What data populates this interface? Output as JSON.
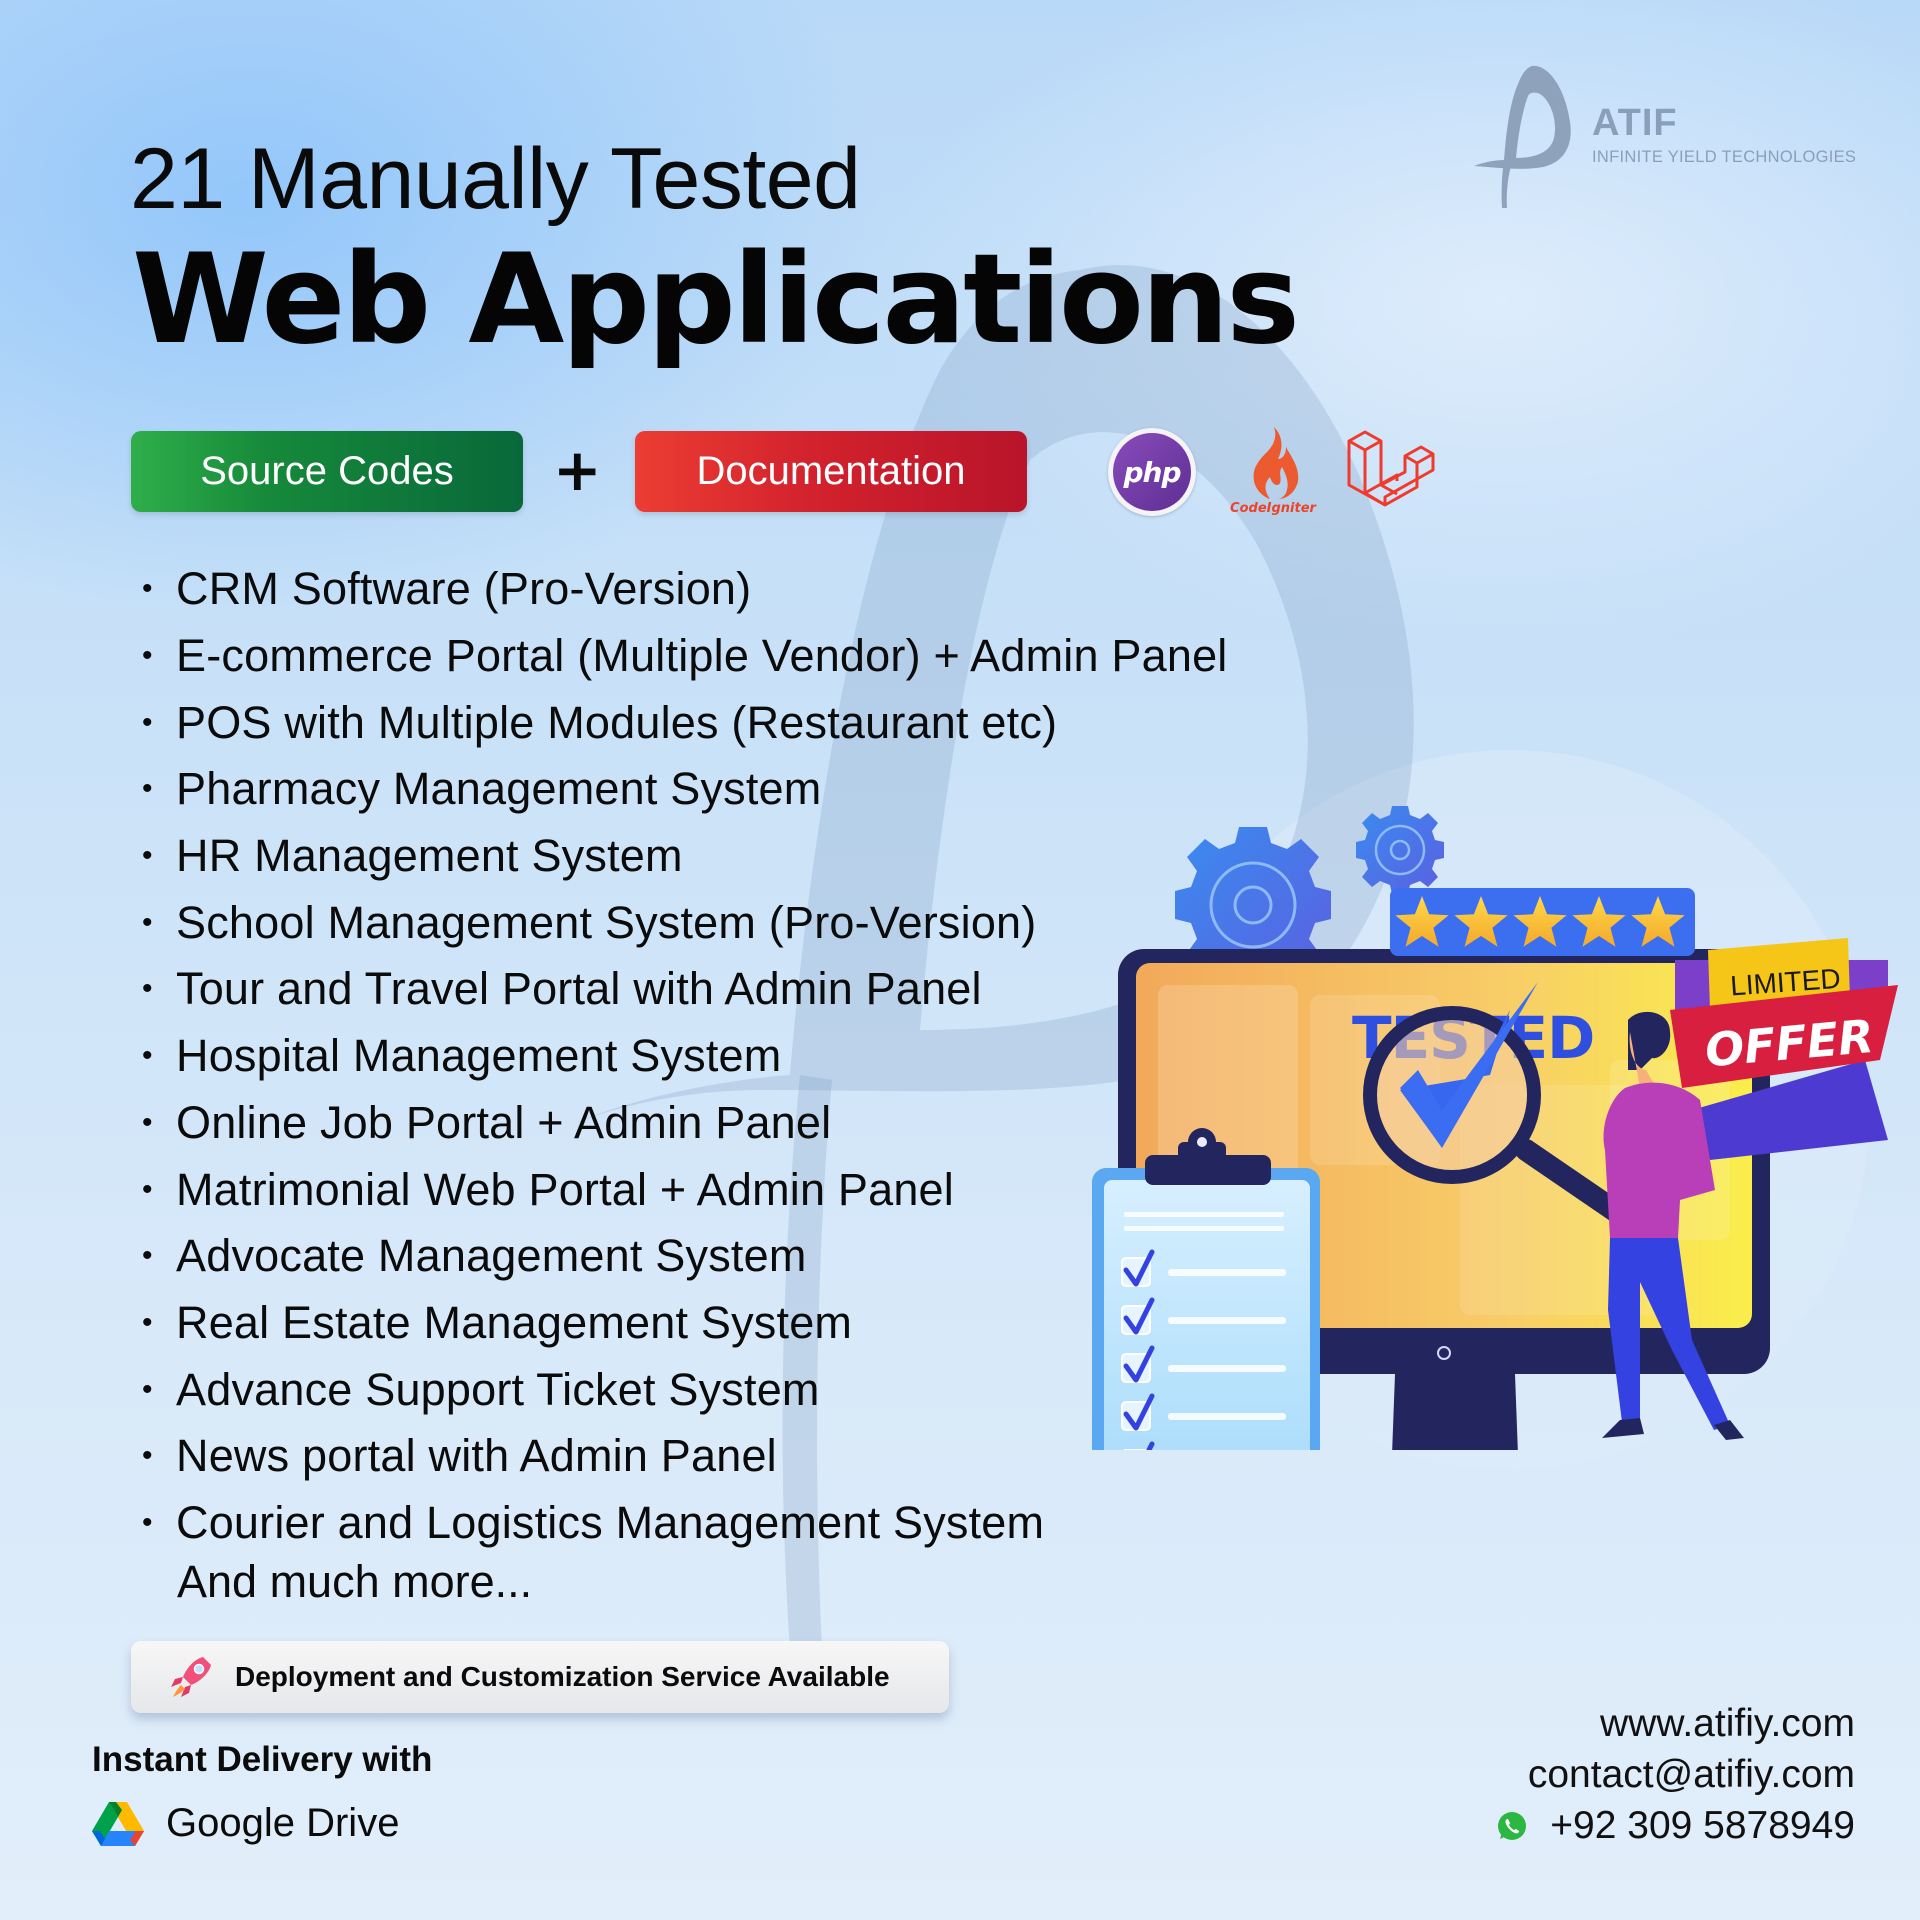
{
  "brand": {
    "name": "ATIF",
    "tagline": "INFINITE YIELD TECHNOLOGIES",
    "logo_icon": "atif-p-logo-icon"
  },
  "header": {
    "subtitle": "21 Manually Tested",
    "title": "Web Applications"
  },
  "badges": {
    "source_codes": "Source Codes",
    "plus": "+",
    "documentation": "Documentation",
    "colors": {
      "source_codes": "#16893a",
      "documentation": "#d2222d"
    }
  },
  "tech_stack": [
    {
      "name": "php",
      "label": "php",
      "icon": "php-logo-icon"
    },
    {
      "name": "codeigniter",
      "label": "CodeIgniter",
      "icon": "codeigniter-flame-icon"
    },
    {
      "name": "laravel",
      "label": "",
      "icon": "laravel-logo-icon"
    }
  ],
  "applications": [
    "CRM Software (Pro-Version)",
    "E-commerce Portal (Multiple Vendor) + Admin Panel",
    "POS with Multiple Modules (Restaurant etc)",
    "Pharmacy Management System",
    "HR Management System",
    "School Management System (Pro-Version)",
    "Tour and Travel Portal with Admin Panel",
    "Hospital Management System",
    "Online Job Portal + Admin Panel",
    "Matrimonial Web Portal + Admin Panel",
    "Advocate Management System",
    "Real Estate Management System",
    "Advance Support Ticket System",
    "News portal with Admin Panel",
    "Courier and Logistics Management System"
  ],
  "more_text": "And much more...",
  "bullet": "•",
  "deployment": {
    "text": "Deployment and Customization Service Available",
    "icon": "rocket-icon"
  },
  "delivery": {
    "label": "Instant Delivery with",
    "service": "Google Drive",
    "icon": "google-drive-icon"
  },
  "contact": {
    "website": "www.atifiy.com",
    "email": "contact@atifiy.com",
    "phone": "+92 309 5878949",
    "phone_icon": "whatsapp-icon"
  },
  "illustration": {
    "screen_text": "TESTED",
    "ribbon_top": "LIMITED",
    "ribbon_main": "OFFER",
    "rating": {
      "stars": 5,
      "max": 5
    },
    "checklist_items_checked": 5,
    "colors": {
      "tested_text": "#2f4fe0",
      "screen": "#f7c65c",
      "ribbon_red": "#d81f3f",
      "ribbon_yellow": "#f5c518",
      "ribbon_purple": "#7b3fc9"
    }
  }
}
